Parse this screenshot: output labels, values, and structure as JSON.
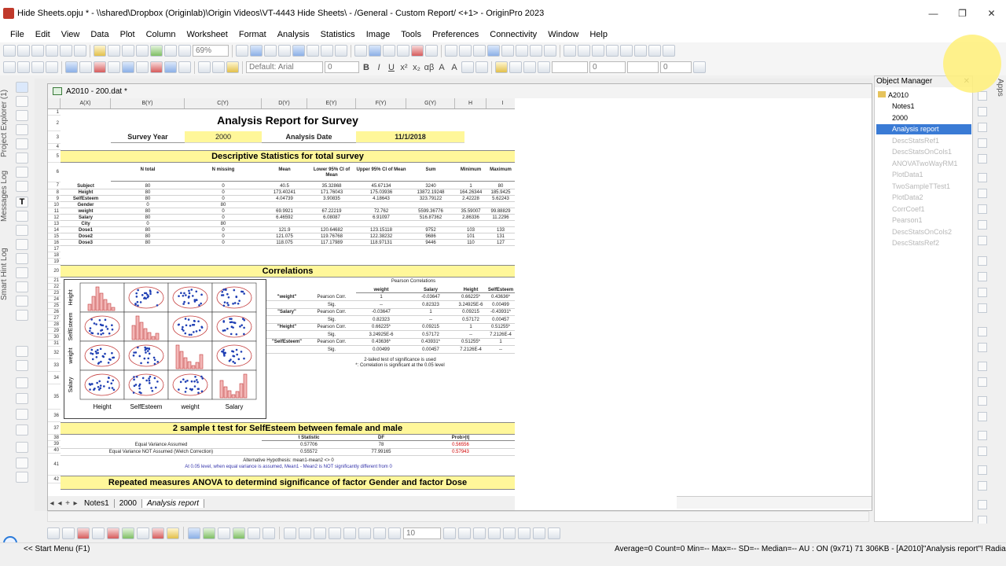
{
  "window": {
    "title": "Hide Sheets.opju * - \\\\shared\\Dropbox (Originlab)\\Origin Videos\\VT-4443 Hide Sheets\\ - /General - Custom Report/ <+1> - OriginPro 2023",
    "minimize": "—",
    "maximize": "❐",
    "close": "✕"
  },
  "menu": [
    "File",
    "Edit",
    "View",
    "Data",
    "Plot",
    "Column",
    "Worksheet",
    "Format",
    "Analysis",
    "Statistics",
    "Image",
    "Tools",
    "Preferences",
    "Connectivity",
    "Window",
    "Help"
  ],
  "toolbar": {
    "zoom": "69%",
    "font": "Default: Arial",
    "font_size": "0",
    "line_width": "0",
    "bottom_size": "10"
  },
  "left_tabs": [
    "Project Explorer (1)",
    "Messages Log",
    "Smart Hint Log"
  ],
  "workbook": {
    "title": "A2010 - 200.dat *",
    "columns": [
      "A(X)",
      "B(Y)",
      "C(Y)",
      "D(Y)",
      "E(Y)",
      "F(Y)",
      "G(Y)",
      "H",
      "I"
    ],
    "rows": [
      "1",
      "2",
      "3",
      "4",
      "5",
      "6",
      "7",
      "8",
      "9",
      "10",
      "11",
      "12",
      "13",
      "14",
      "15",
      "16",
      "17",
      "18",
      "19",
      "20",
      "21",
      "22",
      "23",
      "24",
      "25",
      "26",
      "27",
      "28",
      "29",
      "30",
      "31",
      "32",
      "33",
      "34",
      "35",
      "36",
      "37",
      "38",
      "39",
      "40",
      "41",
      "42"
    ],
    "report_title": "Analysis Report for Survey",
    "survey_year_label": "Survey Year",
    "survey_year": "2000",
    "analysis_date_label": "Analysis Date",
    "analysis_date": "11/1/2018",
    "desc_title": "Descriptive Statistics for total survey",
    "desc_headers": [
      "N total",
      "N missing",
      "Mean",
      "Lower 95% CI of Mean",
      "Upper 95% CI of Mean",
      "Sum",
      "Minimum",
      "Maximum"
    ],
    "desc_rows": [
      [
        "Subject",
        "80",
        "0",
        "40.5",
        "35.32868",
        "45.67134",
        "3240",
        "1",
        "80"
      ],
      [
        "Height",
        "80",
        "0",
        "173.40241",
        "171.76043",
        "175.03936",
        "13872.19248",
        "164.26344",
        "185.9425"
      ],
      [
        "SelfEsteem",
        "80",
        "0",
        "4.04739",
        "3.90835",
        "4.18643",
        "323.79122",
        "2.42228",
        "5.62243"
      ],
      [
        "Gender",
        "0",
        "80",
        "",
        "",
        "",
        "",
        "",
        ""
      ],
      [
        "weight",
        "80",
        "0",
        "69.9921",
        "67.22219",
        "72.762",
        "5599.36776",
        "35.59007",
        "99.88829"
      ],
      [
        "Salary",
        "80",
        "0",
        "6.46592",
        "6.08087",
        "6.91097",
        "516.87362",
        "2.86336",
        "11.2296"
      ],
      [
        "City",
        "0",
        "80",
        "",
        "",
        "",
        "",
        "",
        ""
      ],
      [
        "Dose1",
        "80",
        "0",
        "121.9",
        "120.64682",
        "123.15118",
        "9752",
        "103",
        "133"
      ],
      [
        "Dose2",
        "80",
        "0",
        "121.075",
        "119.76768",
        "122.38232",
        "9686",
        "101",
        "131"
      ],
      [
        "Dose3",
        "80",
        "0",
        "118.075",
        "117.17989",
        "118.97131",
        "9446",
        "110",
        "127"
      ]
    ],
    "corr_title": "Correlations",
    "corr_heading": "Pearson Correlations",
    "corr_headers": [
      "weight",
      "Salary",
      "Height",
      "SelfEsteem"
    ],
    "corr_rows": [
      [
        "\"weight\"",
        "Pearson Corr.",
        "1",
        "-0.03647",
        "0.66225*",
        "0.43636*"
      ],
      [
        "",
        "Sig.",
        "--",
        "0.82323",
        "3.24925E-6",
        "0.00499"
      ],
      [
        "\"Salary\"",
        "Pearson Corr.",
        "-0.03647",
        "1",
        "0.09215",
        "-0.43931*"
      ],
      [
        "",
        "Sig.",
        "0.82323",
        "--",
        "0.57172",
        "0.00457"
      ],
      [
        "\"Height\"",
        "Pearson Corr.",
        "0.66225*",
        "0.09215",
        "1",
        "0.51255*"
      ],
      [
        "",
        "Sig.",
        "3.24925E-6",
        "0.57172",
        "--",
        "7.2126E-4"
      ],
      [
        "\"SelfEsteem\"",
        "Pearson Corr.",
        "0.43636*",
        "0.43931*",
        "0.51255*",
        "1"
      ],
      [
        "",
        "Sig.",
        "0.00499",
        "0.00457",
        "7.2126E-4",
        "--"
      ]
    ],
    "corr_note1": "2-tailed test of significance is used",
    "corr_note2": "*: Correlation is significant at the 0.05 level",
    "matrix_labels": [
      "Height",
      "SelfEsteem",
      "weight",
      "Salary"
    ],
    "ttest_title": "2 sample t test for SelfEsteem between female and male",
    "ttest_headers": [
      "t Statistic",
      "DF",
      "Prob>|t|"
    ],
    "ttest_rows": [
      [
        "Equal Variance Assumed",
        "0.57706",
        "78",
        "0.56556"
      ],
      [
        "Equal Variance NOT Assumed (Welch Correction)",
        "0.55572",
        "77.99165",
        "0.57943"
      ]
    ],
    "ttest_note1": "Alternative Hypothesis: mean1-mean2 <> 0",
    "ttest_note2": "At 0.05 level, when equal variance is assumed, Mean1 - Mean2 is NOT significantly different from 0",
    "anova_title": "Repeated measures ANOVA  to determind significance of factor Gender and factor Dose",
    "sheets": [
      "Notes1",
      "2000",
      "Analysis report"
    ]
  },
  "object_manager": {
    "title": "Object Manager",
    "root": "A2010",
    "items": [
      "Notes1",
      "2000",
      "Analysis report",
      "DescStatsRef1",
      "DescStatsOnCols1",
      "ANOVATwoWayRM1",
      "PlotData1",
      "TwoSampleTTest1",
      "PlotData2",
      "CorrCoef1",
      "Pearson1",
      "DescStatsOnCols2",
      "DescStatsRef2"
    ],
    "dim_from": 3
  },
  "right_tab": "Apps",
  "status": {
    "left": "<< Start Menu (F1)",
    "right": "Average=0  Count=0  Min=--  Max=--  SD=--  Median=--   AU : ON   (9x71) 71   306KB - [A2010]\"Analysis report\"!   Radian"
  }
}
